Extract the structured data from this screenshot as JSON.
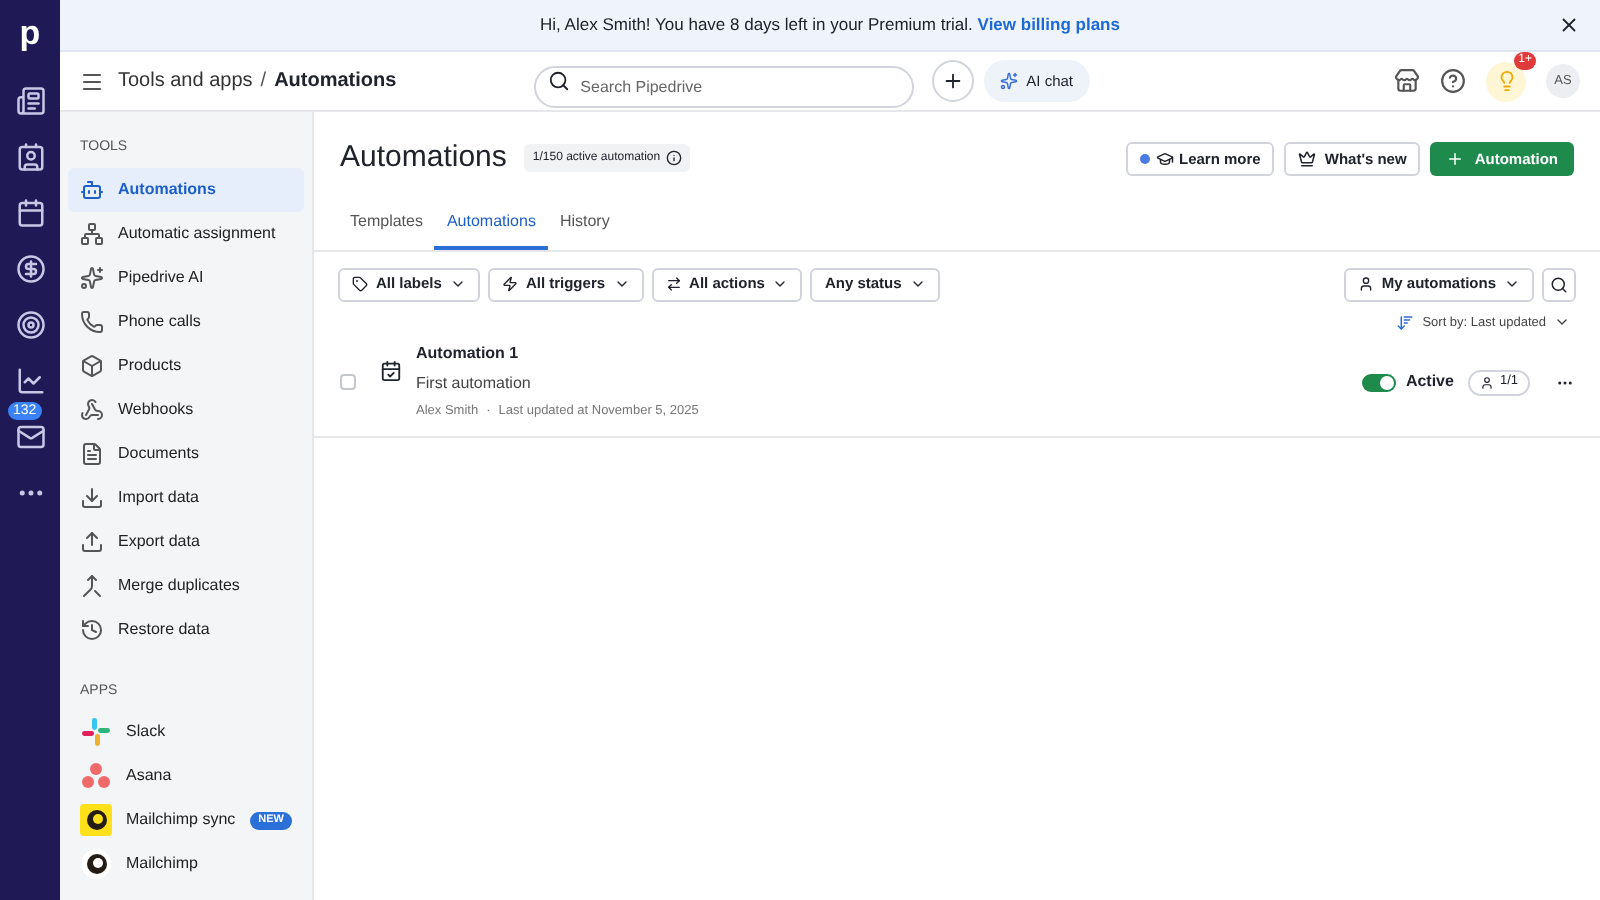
{
  "nav": {
    "logo": "p",
    "mail_badge": "132"
  },
  "banner": {
    "text": "Hi, Alex Smith! You have 8 days left in your Premium trial.",
    "link": "View billing plans"
  },
  "header": {
    "breadcrumb_parent": "Tools and apps",
    "separator": "/",
    "breadcrumb_current": "Automations",
    "search": {
      "placeholder": "Search Pipedrive"
    },
    "ai_chat": "AI chat",
    "notification_badge": "1+",
    "avatar": "AS"
  },
  "sidebar": {
    "sections": [
      {
        "title": "TOOLS",
        "items": [
          {
            "label": "Automations",
            "selected": true
          },
          {
            "label": "Automatic assignment",
            "selected": false
          },
          {
            "label": "Pipedrive AI",
            "selected": false
          },
          {
            "label": "Phone calls",
            "selected": false
          },
          {
            "label": "Products",
            "selected": false
          },
          {
            "label": "Webhooks",
            "selected": false
          },
          {
            "label": "Documents",
            "selected": false
          },
          {
            "label": "Import data",
            "selected": false
          },
          {
            "label": "Export data",
            "selected": false
          },
          {
            "label": "Merge duplicates",
            "selected": false
          },
          {
            "label": "Restore data",
            "selected": false
          }
        ]
      },
      {
        "title": "APPS",
        "items": [
          {
            "label": "Slack",
            "selected": false
          },
          {
            "label": "Asana",
            "selected": false
          },
          {
            "label": "Mailchimp sync",
            "selected": false,
            "badge": "NEW"
          },
          {
            "label": "Mailchimp",
            "selected": false
          }
        ]
      }
    ]
  },
  "page": {
    "title": "Automations",
    "count": "1/150 active automation",
    "buttons": {
      "learn_more": "Learn more",
      "whats_new": "What's new",
      "add": "Automation"
    },
    "tabs": [
      {
        "label": "Templates",
        "selected": false
      },
      {
        "label": "Automations",
        "selected": true
      },
      {
        "label": "History",
        "selected": false
      }
    ],
    "filters": [
      "All labels",
      "All triggers",
      "All actions",
      "Any status"
    ],
    "owner_filter": "My automations",
    "sort": "Sort by: Last updated",
    "rows": [
      {
        "name": "Automation 1",
        "description": "First automation",
        "owner": "Alex Smith",
        "separator": "·",
        "updated": "Last updated at November 5, 2025",
        "checked": false,
        "on": true,
        "status": "Active",
        "users": "1/1"
      }
    ]
  }
}
